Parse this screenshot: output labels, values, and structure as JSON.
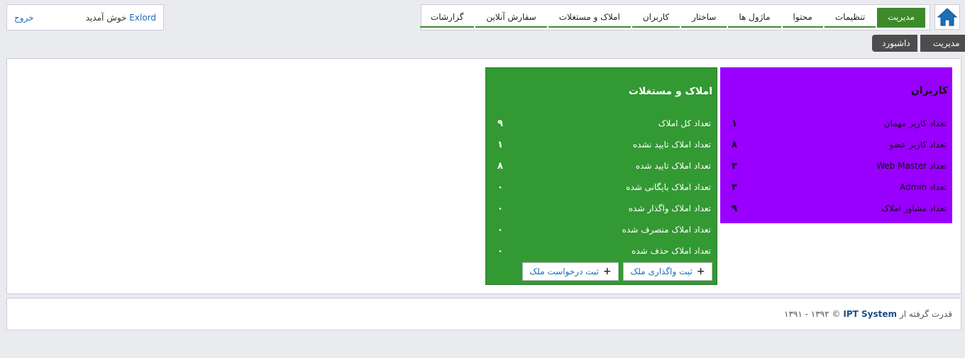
{
  "nav": {
    "items": [
      {
        "label": "مدیریت",
        "active": true
      },
      {
        "label": "تنظیمات",
        "active": false
      },
      {
        "label": "محتوا",
        "active": false
      },
      {
        "label": "ماژول ها",
        "active": false
      },
      {
        "label": "ساختار",
        "active": false
      },
      {
        "label": "کاربران",
        "active": false
      },
      {
        "label": "املاک و مستغلات",
        "active": false
      },
      {
        "label": "سفارش آنلاین",
        "active": false
      },
      {
        "label": "گزارشات",
        "active": false
      }
    ]
  },
  "welcome": {
    "username": "Exlord",
    "greeting": "خوش آمدید",
    "logout": "خروج"
  },
  "breadcrumb": {
    "first": "مدیریت",
    "second": "داشبورد"
  },
  "users_box": {
    "title": "کاربران",
    "color": "#9900ff",
    "rows": [
      {
        "label": "تعداد کاربر مهمان",
        "value": "۱"
      },
      {
        "label": "تعداد کاربر عضو",
        "value": "۸"
      },
      {
        "label": "تعداد Web Master",
        "value": "۳"
      },
      {
        "label": "تعداد Admin",
        "value": "۳"
      },
      {
        "label": "تعداد مشاور املاک",
        "value": "۹"
      }
    ]
  },
  "properties_box": {
    "title": "املاک و مستغلات",
    "color": "#339933",
    "rows": [
      {
        "label": "تعداد کل املاک",
        "value": "۹"
      },
      {
        "label": "تعداد املاک تایید نشده",
        "value": "۱"
      },
      {
        "label": "تعداد املاک تایید شده",
        "value": "۸"
      },
      {
        "label": "تعداد املاک بایگانی شده",
        "value": "۰"
      },
      {
        "label": "تعداد املاک واگذار شده",
        "value": "۰"
      },
      {
        "label": "تعداد املاک منصرف شده",
        "value": "۰"
      },
      {
        "label": "تعداد املاک حذف شده",
        "value": "۰"
      }
    ],
    "buttons": {
      "transfer": "ثبت واگذاری ملک",
      "request": "ثبت درخواست ملک"
    }
  },
  "footer": {
    "prefix": "قدرت گرفته از",
    "brand": "IPT System",
    "copyright": "© ۱۳۹۲ - ۱۳۹۱"
  },
  "icons": {
    "home": "home-icon",
    "plus": "plus-icon"
  }
}
